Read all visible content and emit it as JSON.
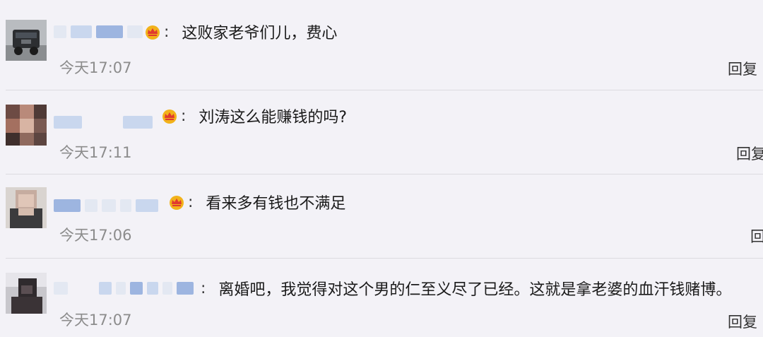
{
  "comments": [
    {
      "text": "这败家老爷们儿，费心",
      "time": "今天17:07",
      "reply_label": "回复",
      "has_vip_crown": true
    },
    {
      "text": "刘涛这么能赚钱的吗?",
      "time": "今天17:11",
      "reply_label": "回复",
      "has_vip_crown": true
    },
    {
      "text": "看来多有钱也不满足",
      "time": "今天17:06",
      "reply_label": "回复",
      "has_vip_crown": true
    },
    {
      "text": "离婚吧，我觉得对这个男的仁至义尽了已经。这就是拿老婆的血汗钱赌博。",
      "time": "今天17:07",
      "reply_label": "回复",
      "has_vip_crown": false
    }
  ],
  "colon": ":",
  "colors": {
    "background": "#f3f2f7",
    "divider": "#dcdbe0",
    "timestamp": "#8c8c8c",
    "crown_gold": "#f2b21a",
    "crown_red": "#e03a2f"
  }
}
